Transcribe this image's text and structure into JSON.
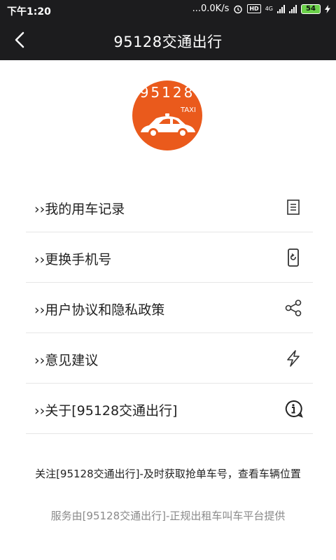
{
  "status_bar": {
    "time": "下午1:20",
    "speed": "...0.0K/s",
    "hd": "HD",
    "network": "4G",
    "battery": "54"
  },
  "nav": {
    "title": "95128交通出行"
  },
  "logo": {
    "number": "95128",
    "taxi": "TAXI",
    "color": "#ea5a1c"
  },
  "menu": {
    "items": [
      {
        "label": "››我的用车记录",
        "icon": "document-icon"
      },
      {
        "label": "››更换手机号",
        "icon": "phone-refresh-icon"
      },
      {
        "label": "››用户协议和隐私政策",
        "icon": "share-icon"
      },
      {
        "label": "››意见建议",
        "icon": "lightning-icon"
      },
      {
        "label": "››关于[95128交通出行]",
        "icon": "info-icon"
      }
    ]
  },
  "notice": "关注[95128交通出行]-及时获取抢单车号，查看车辆位置",
  "footer": "服务由[95128交通出行]-正规出租车叫车平台提供"
}
